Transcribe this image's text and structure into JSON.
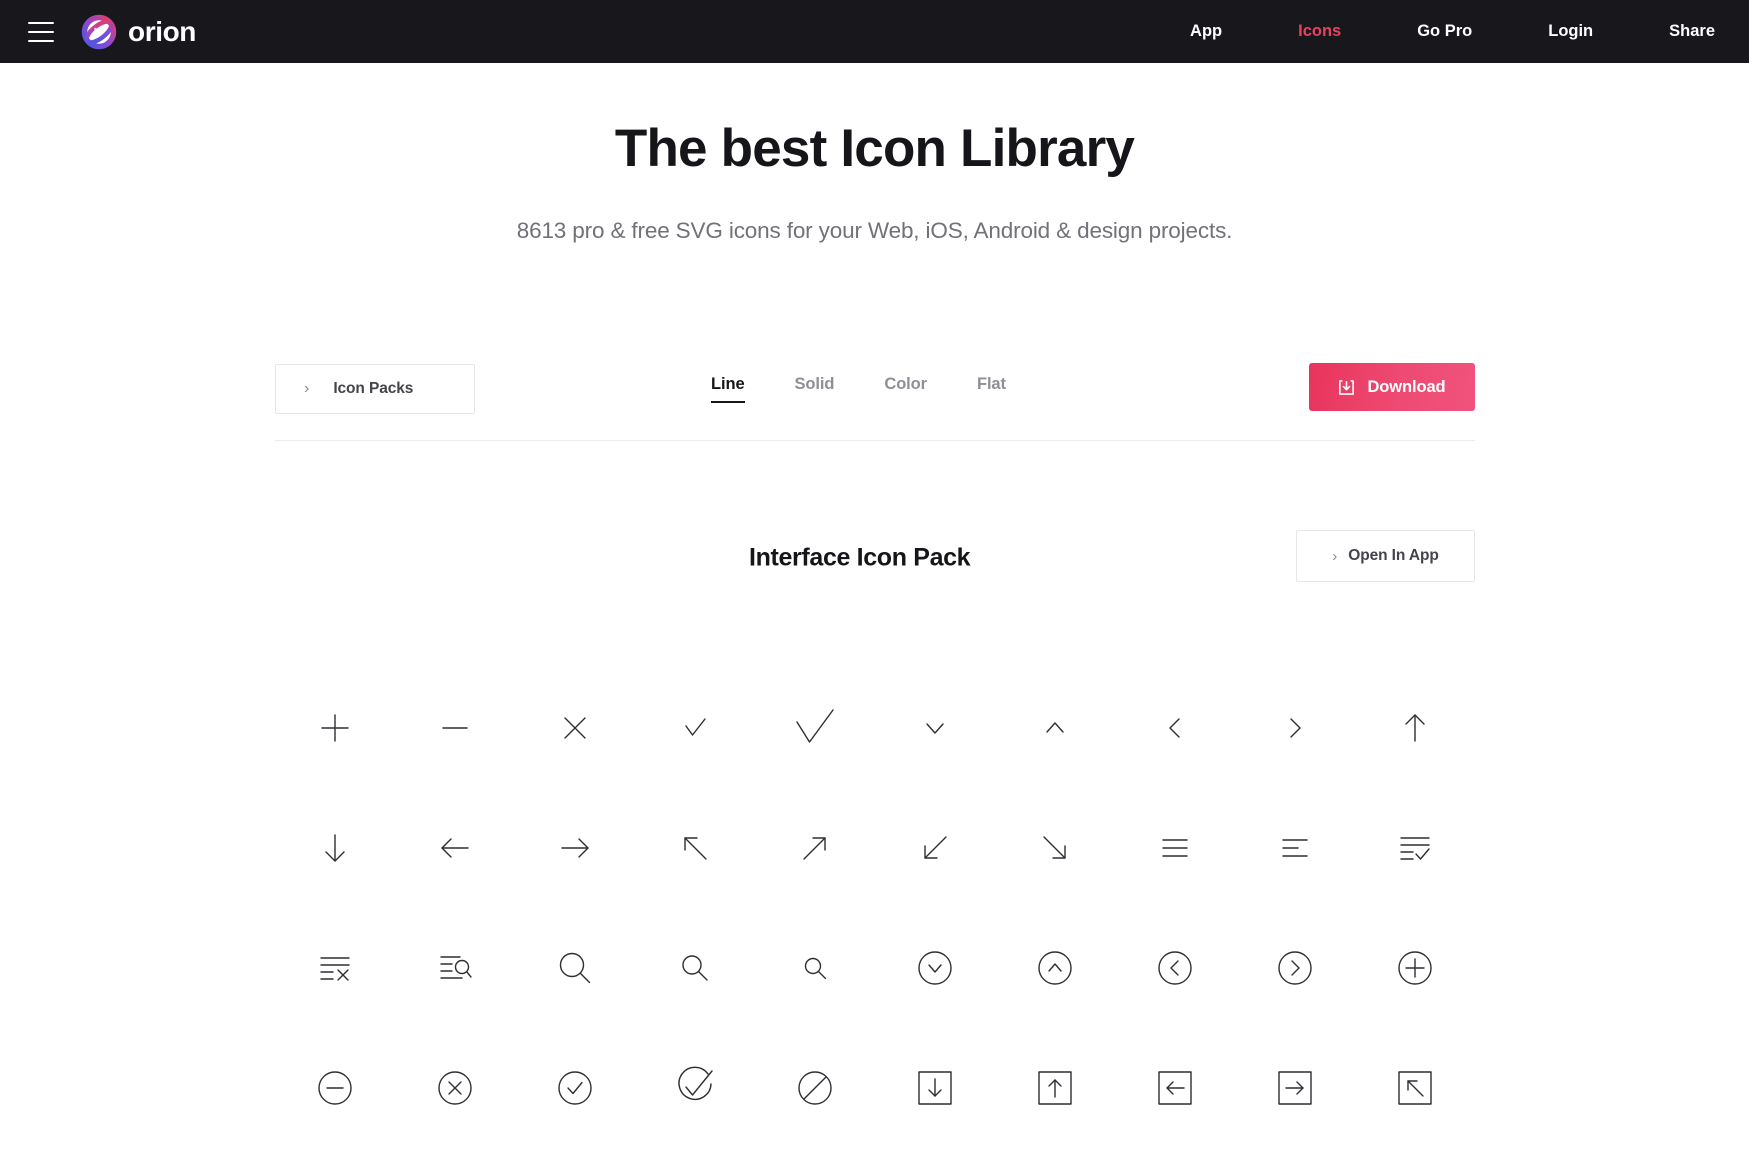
{
  "header": {
    "menu_icon": "hamburger-icon",
    "brand_name": "orion",
    "brand_logo_icon": "orion-logo-icon",
    "nav": [
      {
        "label": "App",
        "active": false
      },
      {
        "label": "Icons",
        "active": true
      },
      {
        "label": "Go Pro",
        "active": false
      },
      {
        "label": "Login",
        "active": false
      },
      {
        "label": "Share",
        "active": false
      }
    ],
    "accent_color": "#e8415f",
    "background_color": "#17171c"
  },
  "hero": {
    "title": "The best Icon Library",
    "subtitle": "8613 pro & free SVG icons for your Web, iOS, Android & design projects.",
    "icon_count": "8613"
  },
  "toolbar": {
    "icon_packs_label": "Icon Packs",
    "icon_packs_chevron": "chevron-right-icon",
    "style_tabs": [
      {
        "label": "Line",
        "active": true
      },
      {
        "label": "Solid",
        "active": false
      },
      {
        "label": "Color",
        "active": false
      },
      {
        "label": "Flat",
        "active": false
      }
    ],
    "download_label": "Download",
    "download_icon": "download-icon",
    "download_color": "#e8345c"
  },
  "pack": {
    "title": "Interface Icon Pack",
    "open_in_app_label": "Open In App",
    "open_in_app_chevron": "chevron-right-icon",
    "icons": [
      {
        "name": "plus-icon"
      },
      {
        "name": "minus-icon"
      },
      {
        "name": "close-x-icon"
      },
      {
        "name": "check-icon"
      },
      {
        "name": "check-large-icon"
      },
      {
        "name": "chevron-down-icon"
      },
      {
        "name": "chevron-up-icon"
      },
      {
        "name": "chevron-left-icon"
      },
      {
        "name": "chevron-right-icon"
      },
      {
        "name": "arrow-up-icon"
      },
      {
        "name": "arrow-down-icon"
      },
      {
        "name": "arrow-left-icon"
      },
      {
        "name": "arrow-right-icon"
      },
      {
        "name": "arrow-up-left-icon"
      },
      {
        "name": "arrow-up-right-icon"
      },
      {
        "name": "arrow-down-left-icon"
      },
      {
        "name": "arrow-down-right-icon"
      },
      {
        "name": "menu-lines-icon"
      },
      {
        "name": "list-align-icon"
      },
      {
        "name": "list-check-icon"
      },
      {
        "name": "list-remove-icon"
      },
      {
        "name": "list-search-icon"
      },
      {
        "name": "search-large-icon"
      },
      {
        "name": "search-medium-icon"
      },
      {
        "name": "search-small-icon"
      },
      {
        "name": "circle-chevron-down-icon"
      },
      {
        "name": "circle-chevron-up-icon"
      },
      {
        "name": "circle-chevron-left-icon"
      },
      {
        "name": "circle-chevron-right-icon"
      },
      {
        "name": "circle-plus-icon"
      },
      {
        "name": "circle-minus-icon"
      },
      {
        "name": "circle-x-icon"
      },
      {
        "name": "circle-check-icon"
      },
      {
        "name": "circle-check-large-icon"
      },
      {
        "name": "circle-slash-icon"
      },
      {
        "name": "square-arrow-down-icon"
      },
      {
        "name": "square-arrow-up-icon"
      },
      {
        "name": "square-arrow-left-icon"
      },
      {
        "name": "square-arrow-right-icon"
      },
      {
        "name": "square-arrow-up-left-icon"
      }
    ]
  }
}
